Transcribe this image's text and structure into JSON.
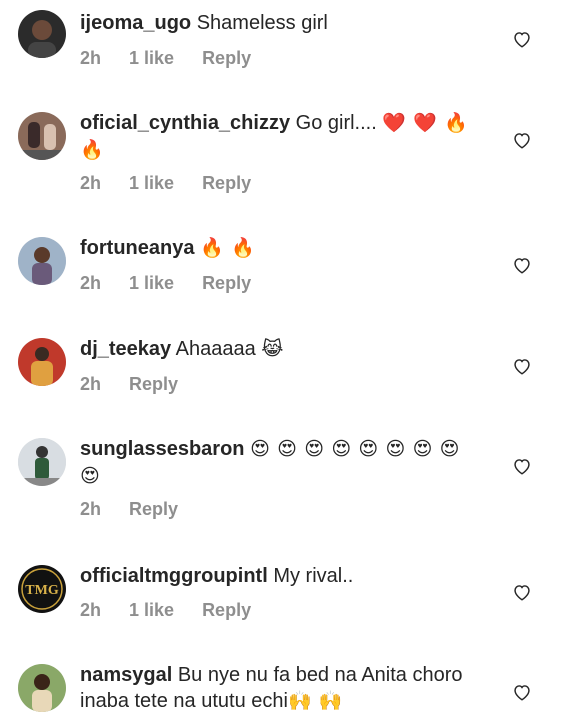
{
  "comments": [
    {
      "username": "ijeoma_ugo",
      "text": "Shameless girl",
      "emoji": "",
      "time": "2h",
      "likes": "1 like",
      "reply": "Reply",
      "avatar_color": "#2b2b2b"
    },
    {
      "username": "oficial_cynthia_chizzy",
      "text": "Go girl....",
      "emoji": "❤️ ❤️ 🔥 🔥",
      "time": "2h",
      "likes": "1 like",
      "reply": "Reply",
      "avatar_color": "#8a6a5a"
    },
    {
      "username": "fortuneanya",
      "text": "",
      "emoji": "🔥 🔥",
      "time": "2h",
      "likes": "1 like",
      "reply": "Reply",
      "avatar_color": "#7a8fa8"
    },
    {
      "username": "dj_teekay",
      "text": "Ahaaaaa",
      "emoji": "😹",
      "time": "2h",
      "likes": "",
      "reply": "Reply",
      "avatar_color": "#c0392b"
    },
    {
      "username": "sunglassesbaron",
      "text": "",
      "emoji": "😍 😍 😍 😍 😍 😍 😍 😍 😍",
      "time": "2h",
      "likes": "",
      "reply": "Reply",
      "avatar_color": "#9aa0a6"
    },
    {
      "username": "officialtmggroupintl",
      "text": "My rival..",
      "emoji": "",
      "time": "2h",
      "likes": "1 like",
      "reply": "Reply",
      "avatar_color": "#111111",
      "avatar_text": "TMG"
    },
    {
      "username": "namsygal",
      "text": "Bu nye nu fa bed na Anita choro inaba tete na ututu echi",
      "emoji": "🙌 🙌",
      "time": "",
      "likes": "",
      "reply": "",
      "avatar_color": "#5a7a3a"
    }
  ],
  "icons": {
    "like": "heart-outline-icon"
  },
  "colors": {
    "text": "#262626",
    "meta": "#8e8e8e",
    "background": "#ffffff"
  }
}
